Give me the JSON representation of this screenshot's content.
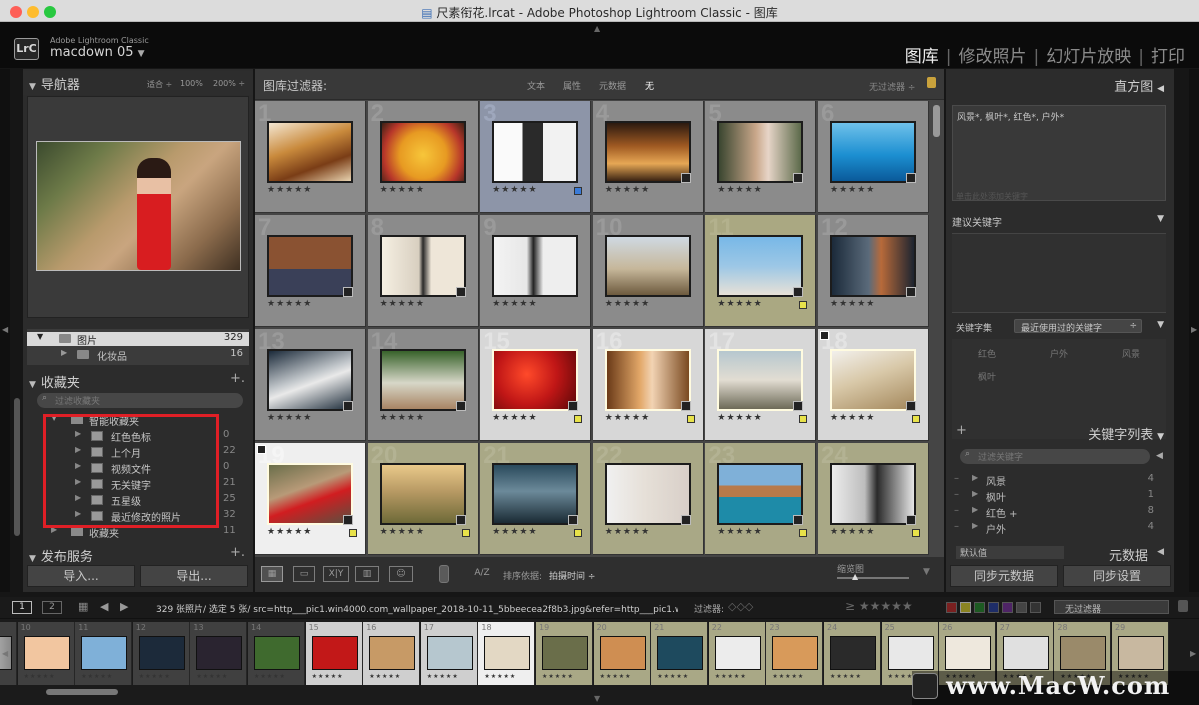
{
  "window": {
    "title": "尺素衔花.lrcat - Adobe Photoshop Lightroom Classic - 图库"
  },
  "identity": {
    "logo": "LrC",
    "product": "Adobe Lightroom Classic",
    "user": "macdown 05",
    "user_arrow": "▼"
  },
  "modules": [
    {
      "label": "图库",
      "active": true
    },
    {
      "label": "修改照片",
      "active": false
    },
    {
      "label": "幻灯片放映",
      "active": false
    },
    {
      "label": "打印",
      "active": false
    }
  ],
  "navigator": {
    "title": "导航器",
    "zoom_fit": "适合 ÷",
    "zoom_100": "100%",
    "zoom_200": "200% ÷"
  },
  "folders": [
    {
      "label": "图片",
      "count": "329"
    },
    {
      "label": "化妆品",
      "count": "16"
    }
  ],
  "collections": {
    "title": "收藏夹",
    "add": "+.",
    "search_placeholder": "过滤收藏夹",
    "smart_parent": "智能收藏夹",
    "items": [
      {
        "label": "红色色标",
        "count": "0"
      },
      {
        "label": "上个月",
        "count": "22"
      },
      {
        "label": "视频文件",
        "count": "0"
      },
      {
        "label": "无关键字",
        "count": "21"
      },
      {
        "label": "五星级",
        "count": "25"
      },
      {
        "label": "最近修改的照片",
        "count": "32"
      }
    ],
    "bottom_item": "收藏夹",
    "bottom_count": "11"
  },
  "publish": {
    "title": "发布服务",
    "add": "+."
  },
  "left_buttons": {
    "import": "导入...",
    "export": "导出..."
  },
  "filter": {
    "title": "图库过滤器:",
    "options": [
      "文本",
      "属性",
      "元数据",
      "无"
    ],
    "preset": "无过滤器 ÷",
    "lock": "🔒"
  },
  "grid": {
    "cells": [
      {
        "n": "1",
        "stars": "★★★★★"
      },
      {
        "n": "2",
        "stars": "★★★★★"
      },
      {
        "n": "3",
        "stars": "★★★★★"
      },
      {
        "n": "4",
        "stars": "★★★★★"
      },
      {
        "n": "5",
        "stars": "★★★★★"
      },
      {
        "n": "6",
        "stars": "★★★★★"
      },
      {
        "n": "7",
        "stars": "★★★★★"
      },
      {
        "n": "8",
        "stars": "★★★★★"
      },
      {
        "n": "9",
        "stars": "★★★★★"
      },
      {
        "n": "10",
        "stars": "★★★★★"
      },
      {
        "n": "11",
        "stars": "★★★★★"
      },
      {
        "n": "12",
        "stars": "★★★★★"
      },
      {
        "n": "13",
        "stars": "★★★★★"
      },
      {
        "n": "14",
        "stars": "★★★★★"
      },
      {
        "n": "15",
        "stars": "★★★★★"
      },
      {
        "n": "16",
        "stars": "★★★★★"
      },
      {
        "n": "17",
        "stars": "★★★★★"
      },
      {
        "n": "18",
        "stars": "★★★★★"
      },
      {
        "n": "19",
        "stars": "★★★★★"
      },
      {
        "n": "20",
        "stars": "★★★★★"
      },
      {
        "n": "21",
        "stars": "★★★★★"
      },
      {
        "n": "22",
        "stars": "★★★★★"
      },
      {
        "n": "23",
        "stars": "★★★★★"
      },
      {
        "n": "24",
        "stars": "★★★★★"
      }
    ]
  },
  "toolbar": {
    "sort_label": "排序依据:",
    "sort_value": "拍摄时间 ÷",
    "thumb_label": "缩览图",
    "view_xy": "X|Y",
    "az": "A/Z"
  },
  "histogram": {
    "title": "直方图",
    "arrow": "◀"
  },
  "keywording": {
    "tags": "风景*, 枫叶*, 红色*, 户外*",
    "tags_placeholder": "单击此处添加关键字",
    "suggest_title": "建议关键字",
    "set_label": "关键字集",
    "set_value": "最近使用过的关键字",
    "set_cells": [
      "红色",
      "户外",
      "风景",
      "枫叶"
    ]
  },
  "keyword_list": {
    "title": "关键字列表",
    "add": "+",
    "search_placeholder": "过滤关键字",
    "items": [
      {
        "label": "风景",
        "count": "4"
      },
      {
        "label": "枫叶",
        "count": "1"
      },
      {
        "label": "红色 +",
        "count": "8"
      },
      {
        "label": "户外",
        "count": "4"
      }
    ]
  },
  "metadata": {
    "preset": "默认值",
    "title": "元数据",
    "arrow": "◀"
  },
  "right_buttons": {
    "sync_meta": "同步元数据",
    "sync_settings": "同步设置"
  },
  "filmstrip": {
    "view1": "1",
    "view2": "2",
    "info": "329 张照片/ 选定 5 张/ src=http___pic1.win4000.com_wallpaper_2018-10-11_5bbeecea2f8b3.jpg&refer=http___pic1.win400(",
    "filter_label": "过滤器:",
    "filter_preset": "无过滤器",
    "numbers": [
      "",
      "10",
      "11",
      "12",
      "13",
      "14",
      "15",
      "16",
      "17",
      "18",
      "19",
      "20",
      "21",
      "22",
      "23",
      "24",
      "25",
      "26",
      "27",
      "28",
      "29"
    ]
  },
  "watermark": "www.MacW.com",
  "colors": {
    "accent_red": "#e01f26",
    "selection": "#c9c8a6",
    "lightbg": "#d7d7d7"
  }
}
